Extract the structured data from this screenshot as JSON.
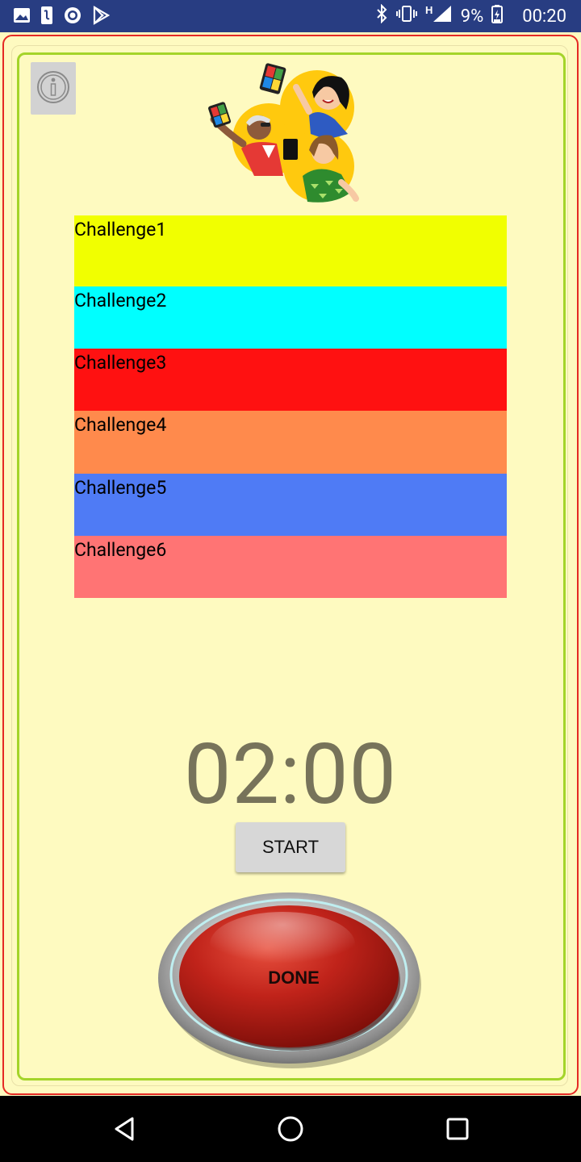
{
  "status_bar": {
    "left_icons": [
      "image-icon",
      "phone-icon",
      "circle-app-icon",
      "play-store-icon"
    ],
    "right_icons": [
      "bluetooth-icon",
      "vibrate-icon",
      "network-h-icon",
      "signal-icon"
    ],
    "battery": "9%",
    "time": "00:20"
  },
  "header": {
    "info_icon": "info-icon",
    "illustration": "people-with-phones-illustration"
  },
  "challenges": [
    {
      "label": "Challenge1",
      "color": "#f1ff00"
    },
    {
      "label": "Challenge2",
      "color": "#00ffff"
    },
    {
      "label": "Challenge3",
      "color": "#ff1111"
    },
    {
      "label": "Challenge4",
      "color": "#ff8a4c"
    },
    {
      "label": "Challenge5",
      "color": "#4f7bf5"
    },
    {
      "label": "Challenge6",
      "color": "#ff7474"
    }
  ],
  "timer": {
    "value": "02:00"
  },
  "controls": {
    "start_label": "START",
    "done_label": "DONE"
  },
  "colors": {
    "background": "#fefac0",
    "frame_outer": "#e52a25",
    "frame_inner": "#a4d42a",
    "status_bar": "#283d82",
    "timer_text": "#77735a"
  },
  "nav_bar": {
    "buttons": [
      "back-icon",
      "home-icon",
      "recents-icon"
    ]
  }
}
